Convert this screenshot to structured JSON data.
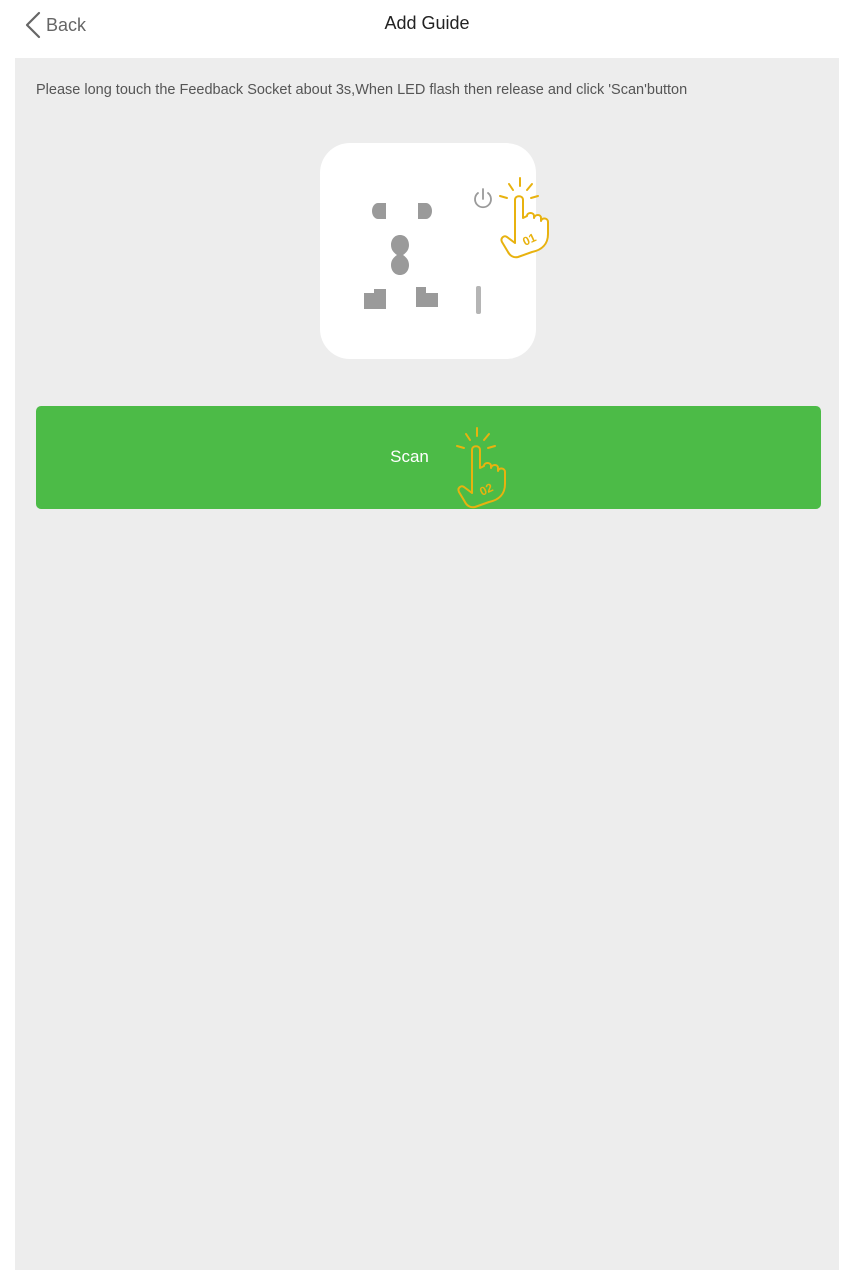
{
  "header": {
    "back_label": "Back",
    "title": "Add Guide"
  },
  "instruction": "Please long touch the Feedback Socket about 3s,When LED flash then release and click 'Scan'button",
  "steps": {
    "step1": "01",
    "step2": "02"
  },
  "scan_button": {
    "label": "Scan"
  },
  "colors": {
    "accent_green": "#4cbb47",
    "hand_gold": "#e8b20f",
    "background": "#ededed"
  }
}
